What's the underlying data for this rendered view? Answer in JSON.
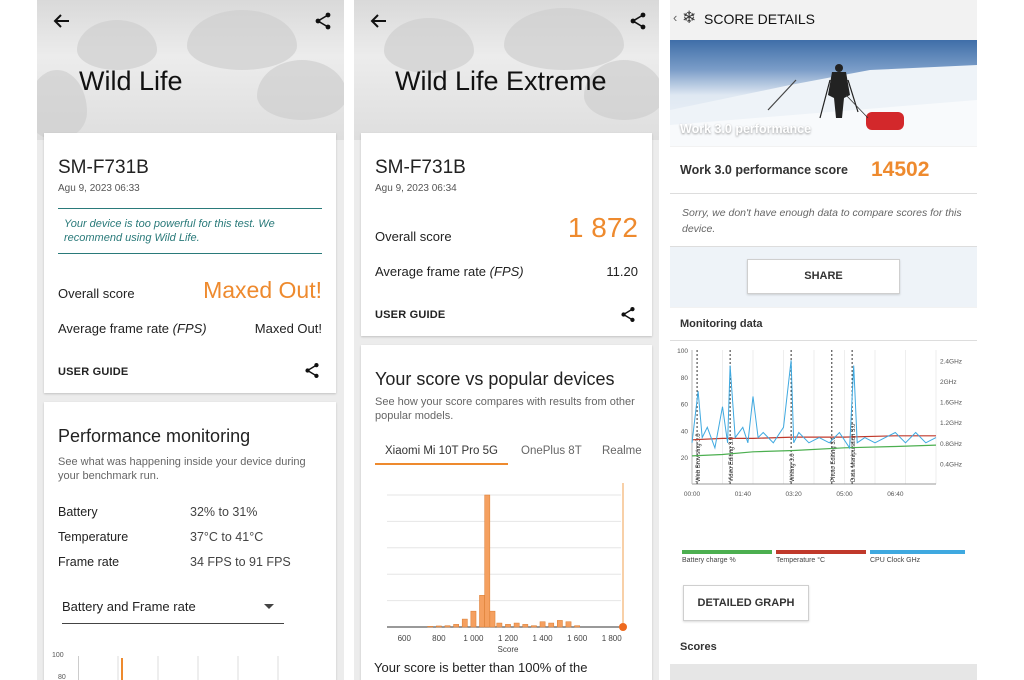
{
  "panel1": {
    "title": "Wild Life",
    "device": "SM-F731B",
    "date": "Agu 9, 2023 06:33",
    "note": "Your device is too powerful for this test. We recommend using Wild Life.",
    "overall_label": "Overall score",
    "overall_value": "Maxed Out!",
    "fps_label": "Average frame rate",
    "fps_unit": "(FPS)",
    "fps_value": "Maxed Out!",
    "user_guide": "USER GUIDE",
    "perf_title": "Performance monitoring",
    "perf_sub": "See what was happening inside your device during your benchmark run.",
    "stats": [
      {
        "label": "Battery",
        "value": "32% to 31%"
      },
      {
        "label": "Temperature",
        "value": "37°C to 41°C"
      },
      {
        "label": "Frame rate",
        "value": "34 FPS to 91 FPS"
      }
    ],
    "dropdown": "Battery and Frame rate",
    "mini_axis": [
      "100",
      "80"
    ]
  },
  "panel2": {
    "title": "Wild Life Extreme",
    "device": "SM-F731B",
    "date": "Agu 9, 2023 06:34",
    "overall_label": "Overall score",
    "overall_value": "1 872",
    "fps_label": "Average frame rate",
    "fps_unit": "(FPS)",
    "fps_value": "11.20",
    "user_guide": "USER GUIDE",
    "compare_title": "Your score vs popular devices",
    "compare_sub": "See how your score compares with results from other popular models.",
    "tabs": [
      "Xiaomi Mi 10T Pro 5G",
      "OnePlus 8T",
      "Realme"
    ],
    "better_text": "Your score is better than 100% of the"
  },
  "panel3": {
    "header": "SCORE DETAILS",
    "photo_label": "Work 3.0 performance",
    "score_label": "Work 3.0 performance score",
    "score_value": "14502",
    "sorry": "Sorry, we don't have enough data to compare scores for this device.",
    "share": "SHARE",
    "monitoring": "Monitoring data",
    "legend": [
      {
        "label": "Battery charge %",
        "color": "#4caf50"
      },
      {
        "label": "Temperature °C",
        "color": "#c0392b"
      },
      {
        "label": "CPU Clock GHz",
        "color": "#3fa9e0"
      }
    ],
    "detailed": "DETAILED GRAPH",
    "scores": "Scores"
  },
  "colors": {
    "accent": "#ee8a2e",
    "note": "#2a7a7a",
    "cpu": "#3fa9e0"
  },
  "chart_data": [
    {
      "type": "bar",
      "title": "",
      "xlabel": "Score",
      "ylabel": "",
      "x_ticks": [
        "600",
        "800",
        "1 000",
        "1 200",
        "1 400",
        "1 600",
        "1 800"
      ],
      "xlim": [
        500,
        1900
      ],
      "bins": [
        {
          "x": 750,
          "y": 0.5
        },
        {
          "x": 800,
          "y": 0.8
        },
        {
          "x": 850,
          "y": 1
        },
        {
          "x": 900,
          "y": 2
        },
        {
          "x": 950,
          "y": 6
        },
        {
          "x": 1000,
          "y": 12
        },
        {
          "x": 1050,
          "y": 24
        },
        {
          "x": 1080,
          "y": 100
        },
        {
          "x": 1110,
          "y": 12
        },
        {
          "x": 1150,
          "y": 3
        },
        {
          "x": 1200,
          "y": 2
        },
        {
          "x": 1250,
          "y": 3
        },
        {
          "x": 1300,
          "y": 2
        },
        {
          "x": 1350,
          "y": 1
        },
        {
          "x": 1400,
          "y": 4
        },
        {
          "x": 1450,
          "y": 3
        },
        {
          "x": 1500,
          "y": 5
        },
        {
          "x": 1550,
          "y": 4
        },
        {
          "x": 1600,
          "y": 1
        }
      ],
      "your_score": 1872
    },
    {
      "type": "line",
      "title": "",
      "x_ticks": [
        "00:00",
        "01:40",
        "03:20",
        "05:00",
        "06:40"
      ],
      "y_left_ticks": [
        "20",
        "40",
        "60",
        "80",
        "100"
      ],
      "y_right_ticks": [
        "0.4GHz",
        "0.8GHz",
        "1.2GHz",
        "1.6GHz",
        "2GHz",
        "2.4GHz"
      ],
      "ylim_left": [
        0,
        100
      ],
      "ylim_right": [
        0,
        2.6
      ],
      "xlim": [
        0,
        480
      ],
      "annotations": [
        "Web Browsing 3.0",
        "Video Editing 3.0",
        "Writing 3.0",
        "Photo Editing 3.0",
        "Data Manipulation 3.0"
      ],
      "annotation_x": [
        10,
        75,
        195,
        275,
        315
      ],
      "series": [
        {
          "name": "Battery charge %",
          "x": [
            0,
            60,
            120,
            200,
            300,
            400,
            480
          ],
          "y": [
            21,
            22,
            24,
            25,
            27,
            28,
            29
          ]
        },
        {
          "name": "Temperature °C",
          "x": [
            0,
            60,
            120,
            200,
            300,
            400,
            480
          ],
          "y": [
            33,
            34,
            34,
            35,
            35,
            36,
            36
          ]
        },
        {
          "name": "CPU Clock GHz",
          "x": [
            0,
            12,
            20,
            30,
            45,
            60,
            70,
            75,
            85,
            100,
            110,
            120,
            130,
            140,
            160,
            180,
            195,
            200,
            210,
            230,
            250,
            270,
            290,
            310,
            318,
            325,
            340,
            360,
            380,
            400,
            420,
            440,
            460,
            480
          ],
          "y": [
            0.8,
            1.8,
            0.9,
            1.1,
            0.7,
            1.5,
            0.8,
            2.3,
            0.9,
            1.1,
            0.8,
            1.7,
            0.9,
            1.0,
            0.8,
            1.1,
            2.4,
            0.8,
            1.0,
            0.8,
            0.9,
            0.8,
            1.0,
            0.7,
            2.3,
            0.8,
            0.9,
            0.8,
            0.9,
            1.0,
            0.8,
            1.0,
            0.8,
            0.9
          ]
        }
      ]
    }
  ]
}
